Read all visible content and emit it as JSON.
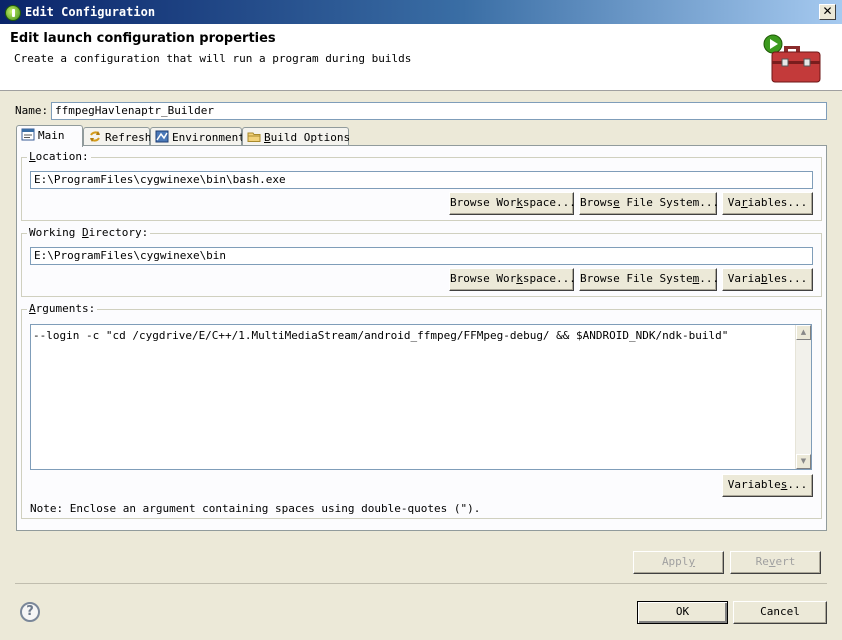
{
  "window": {
    "title": "Edit Configuration",
    "close_glyph": "✕"
  },
  "header": {
    "heading": "Edit launch configuration properties",
    "description": "Create a configuration that will run a program during builds",
    "icon": "toolbox-run-icon"
  },
  "name": {
    "label": "Name:",
    "value": "ffmpegHavlenaptr_Builder"
  },
  "tabs": [
    {
      "label": "Main",
      "icon": "main-tab-icon",
      "active": true
    },
    {
      "label": "Refresh",
      "icon": "refresh-icon",
      "active": false
    },
    {
      "label": "Environment",
      "icon": "environment-icon",
      "active": false
    },
    {
      "label": "Build Options",
      "icon": "folder-icon",
      "active": false
    }
  ],
  "location": {
    "label": "Location:",
    "value": "E:\\ProgramFiles\\cygwinexe\\bin\\bash.exe",
    "browse_workspace": "Browse Workspace...",
    "browse_file_system": "Browse File System...",
    "variables": "Variables..."
  },
  "working_directory": {
    "label": "Working Directory:",
    "value": "E:\\ProgramFiles\\cygwinexe\\bin",
    "browse_workspace": "Browse Workspace...",
    "browse_file_system": "Browse File System...",
    "variables": "Variables..."
  },
  "arguments": {
    "label": "Arguments:",
    "value": "--login -c \"cd /cygdrive/E/C++/1.MultiMediaStream/android_ffmpeg/FFMpeg-debug/ && $ANDROID_NDK/ndk-build\"",
    "variables": "Variables...",
    "note": "Note: Enclose an argument containing spaces using double-quotes (\")."
  },
  "footer": {
    "apply": "Apply",
    "revert": "Revert",
    "ok": "OK",
    "cancel": "Cancel",
    "help_glyph": "?"
  },
  "colors": {
    "title_gradient_start": "#0a246a",
    "title_gradient_end": "#a6caf0",
    "dialog_background": "#ece9d8",
    "input_border": "#7f9db9"
  }
}
